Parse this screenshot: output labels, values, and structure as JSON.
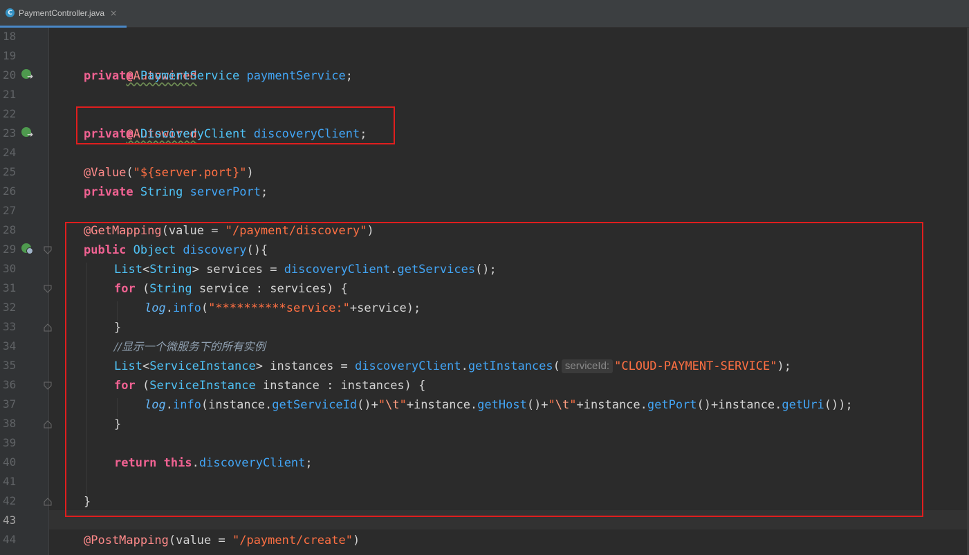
{
  "tab": {
    "icon": "C",
    "label": "PaymentController.java",
    "close": "×"
  },
  "gutter": {
    "line_numbers": [
      "18",
      "19",
      "20",
      "21",
      "22",
      "23",
      "24",
      "25",
      "26",
      "27",
      "28",
      "29",
      "30",
      "31",
      "32",
      "33",
      "34",
      "35",
      "36",
      "37",
      "38",
      "39",
      "40",
      "41",
      "42",
      "43",
      "44"
    ],
    "current_line": "43"
  },
  "code": {
    "l19": {
      "ann": "@Autowired"
    },
    "l20": {
      "kw": "private",
      "type": "PaymentService",
      "field": "paymentService",
      "end": ";"
    },
    "l22": {
      "ann": "@Autowired"
    },
    "l23": {
      "kw": "private",
      "type": "DiscoveryClient",
      "field": "discoveryClient",
      "end": ";"
    },
    "l25": {
      "ann": "@Value",
      "open": "(",
      "str": "\"${server.port}\"",
      "close": ")"
    },
    "l26": {
      "kw": "private",
      "type": "String",
      "field": "serverPort",
      "end": ";"
    },
    "l28": {
      "ann": "@GetMapping",
      "open": "(",
      "param": "value",
      "eq": " = ",
      "str": "\"/payment/discovery\"",
      "close": ")"
    },
    "l29": {
      "kw": "public",
      "type": "Object",
      "method": "discovery",
      "rest": "(){"
    },
    "l30": {
      "t1": "List",
      "lt": "<",
      "t2": "String",
      "gt": "> services = ",
      "field": "discoveryClient",
      "dot": ".",
      "method": "getServices",
      "rest": "();"
    },
    "l31": {
      "kw": "for",
      "open": " (",
      "type": "String",
      "rest": " service : services) {"
    },
    "l32": {
      "log": "log",
      "dot": ".",
      "method": "info",
      "open": "(",
      "str": "\"**********service:\"",
      "rest": "+service);"
    },
    "l33": {
      "text": "}"
    },
    "l34": {
      "comment": "//显示一个微服务下的所有实例"
    },
    "l35": {
      "t1": "List",
      "lt": "<",
      "t2": "ServiceInstance",
      "gt": "> instances = ",
      "field": "discoveryClient",
      "dot": ".",
      "method": "getInstances",
      "open": "(",
      "hint": "serviceId:",
      "str": "\"CLOUD-PAYMENT-SERVICE\"",
      "rest": ");"
    },
    "l36": {
      "kw": "for",
      "open": " (",
      "type": "ServiceInstance",
      "rest": " instance : instances) {"
    },
    "l37": {
      "log": "log",
      "dot": ".",
      "method": "info",
      "open": "(instance.",
      "m1": "getServiceId",
      "p1": "()+",
      "q1": "\"",
      "e1": "\\t",
      "q2": "\"",
      "p2": "+instance.",
      "m2": "getHost",
      "p3": "()+",
      "q3": "\"",
      "e2": "\\t",
      "q4": "\"",
      "p4": "+instance.",
      "m3": "getPort",
      "p5": "()+instance.",
      "m4": "getUri",
      "p6": "());"
    },
    "l38": {
      "text": "}"
    },
    "l40": {
      "kw": "return",
      "sp": " ",
      "kw2": "this",
      "dot": ".",
      "field": "discoveryClient",
      "end": ";"
    },
    "l42": {
      "text": "}"
    },
    "l44": {
      "ann": "@PostMapping",
      "open": "(",
      "param": "value",
      "eq": " = ",
      "str": "\"/payment/create\"",
      "close": ")"
    }
  },
  "colors": {
    "background": "#2b2b2b",
    "keyword": "#f06292",
    "annotation": "#ff8a8a",
    "type": "#4fc3f7",
    "string": "#ff7043",
    "highlight_box": "#e01e1e"
  }
}
